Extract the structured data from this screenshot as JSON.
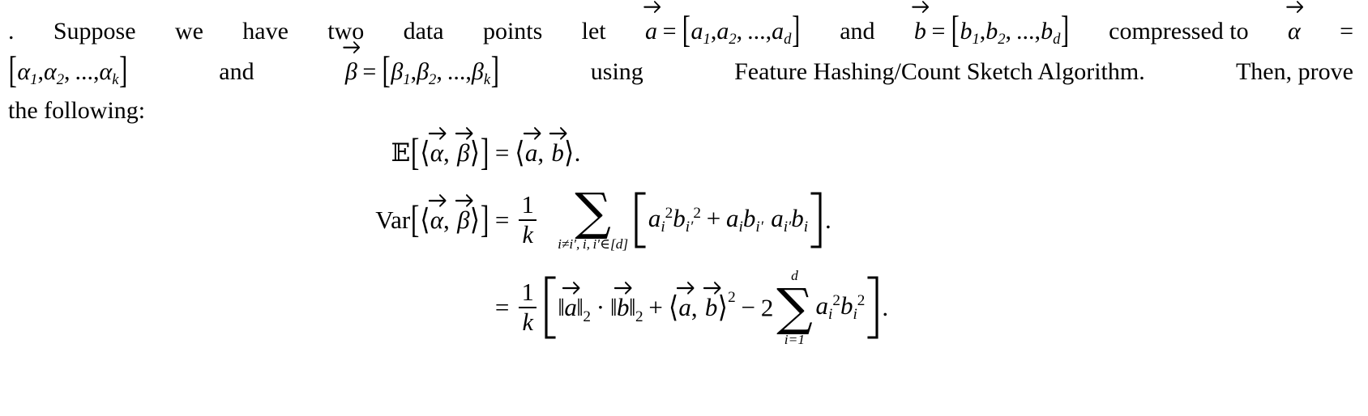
{
  "document": {
    "type": "math-problem-statement",
    "background_color": "#ffffff",
    "text_color": "#000000"
  },
  "paragraph": {
    "leader": ".",
    "line1": {
      "words": [
        "Suppose",
        "we",
        "have",
        "two",
        "data",
        "points",
        "let"
      ],
      "math_a_def": "a⃗ = [a₁, a₂, ..., a_d]",
      "and": "and",
      "math_b_def": "b⃗ = [b₁, b₂, ..., b_d]",
      "compressed_to": "compressed to",
      "alpha_vec": "α⃗",
      "equals": "="
    },
    "line2": {
      "alpha_list": "[α₁, α₂, ..., α_k]",
      "and": "and",
      "beta_def": "β⃗ = [β₁, β₂, ..., β_k]",
      "using": "using",
      "algorithm_name": "Feature Hashing/Count Sketch Algorithm.",
      "then_prove": "Then, prove"
    },
    "line3": "the following:",
    "symbols": {
      "a": "a",
      "b": "b",
      "alpha": "α",
      "beta": "β",
      "d": "d",
      "k": "k",
      "sub1": "1",
      "sub2": "2",
      "ellipsis": ", ...,",
      "bracket_open": "[",
      "bracket_close": "]",
      "comma": ","
    }
  },
  "equations": {
    "eq1": {
      "lhs_operator": "𝔼",
      "lhs_bracket_open": "[",
      "lhs_inner_open": "⟨",
      "lhs_alpha": "α",
      "lhs_comma": ",",
      "lhs_beta": "β",
      "lhs_inner_close": "⟩",
      "lhs_bracket_close": "]",
      "relation": "=",
      "rhs_open": "⟨",
      "rhs_a": "a",
      "rhs_comma": ",",
      "rhs_b": "b",
      "rhs_close": "⟩",
      "period": "."
    },
    "eq2": {
      "lhs_operator": "Var",
      "lhs_bracket_open": "[",
      "lhs_inner_open": "⟨",
      "lhs_alpha": "α",
      "lhs_comma": ",",
      "lhs_beta": "β",
      "lhs_inner_close": "⟩",
      "lhs_bracket_close": "]",
      "relation": "=",
      "frac_num": "1",
      "frac_den": "k",
      "sum_glyph": "∑",
      "sum_limit": "i≠i′, i, i′∈[d]",
      "term1_a": "a",
      "term1_a_sub": "i",
      "term1_a_sup": "2",
      "term1_b": "b",
      "term1_b_sub": "i′",
      "term1_b_sup": "2",
      "plus": "+",
      "term2_a": "a",
      "term2_a_sub": "i",
      "term2_b": "b",
      "term2_b_sub": "i′",
      "term2_a2": "a",
      "term2_a2_sub": "i′",
      "term2_b2": "b",
      "term2_b2_sub": "i",
      "period": "."
    },
    "eq3": {
      "relation": "=",
      "frac_num": "1",
      "frac_den": "k",
      "norm_a": "‖a‖",
      "norm_a_sub": "2",
      "cdot": "·",
      "norm_b": "‖b‖",
      "norm_b_sub": "2",
      "plus": "+",
      "inner_open": "⟨",
      "inner_a": "a",
      "inner_comma": ",",
      "inner_b": "b",
      "inner_close": "⟩",
      "inner_sup": "2",
      "minus": "−",
      "coefficient": "2",
      "sum_glyph": "∑",
      "sum_upper": "d",
      "sum_lower": "i=1",
      "term_a": "a",
      "term_a_sub": "i",
      "term_a_sup": "2",
      "term_b": "b",
      "term_b_sub": "i",
      "term_b_sup": "2",
      "period": "."
    }
  }
}
